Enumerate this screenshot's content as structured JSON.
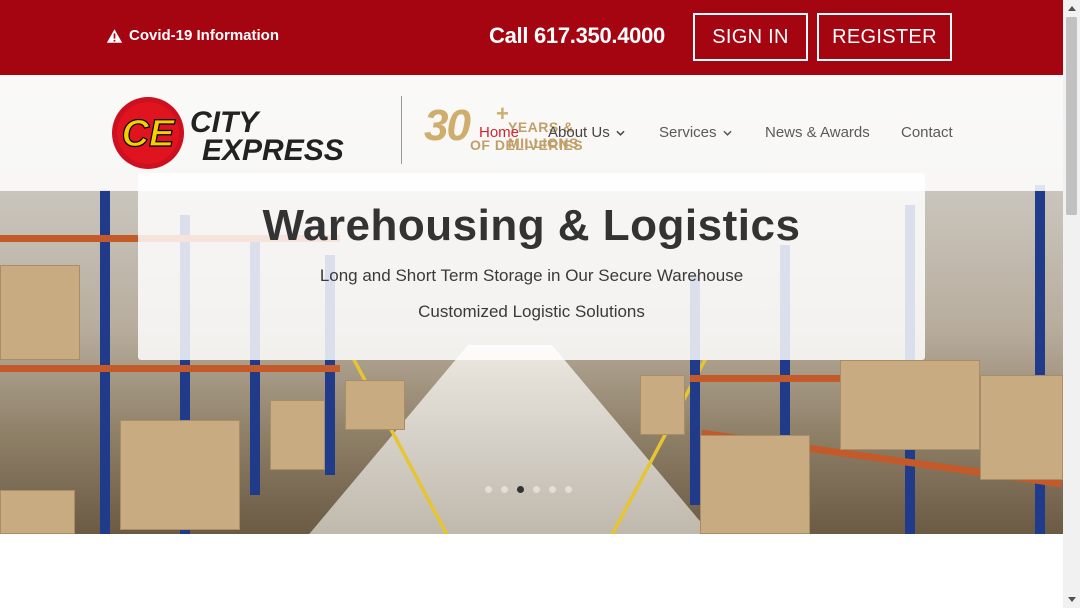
{
  "topbar": {
    "covid_label": "Covid-19 Information",
    "call_text": "Call 617.350.4000",
    "signin_label": "SIGN IN",
    "register_label": "REGISTER"
  },
  "logo": {
    "monogram": "CE",
    "line1": "CITY",
    "line2": "EXPRESS"
  },
  "badge": {
    "number": "30",
    "plus": "+",
    "line1": "YEARS & MILLIONS",
    "line2": "OF DELIVERIES"
  },
  "nav": {
    "home": "Home",
    "about": "About Us",
    "services": "Services",
    "news": "News & Awards",
    "contact": "Contact"
  },
  "hero": {
    "title": "Warehousing & Logistics",
    "line1": "Long and Short Term Storage in Our Secure Warehouse",
    "line2": "Customized Logistic Solutions",
    "slide_count": 6,
    "active_slide": 3
  },
  "colors": {
    "brand_red": "#a50511",
    "nav_active": "#d0272e",
    "logo_yellow": "#f5d000"
  }
}
